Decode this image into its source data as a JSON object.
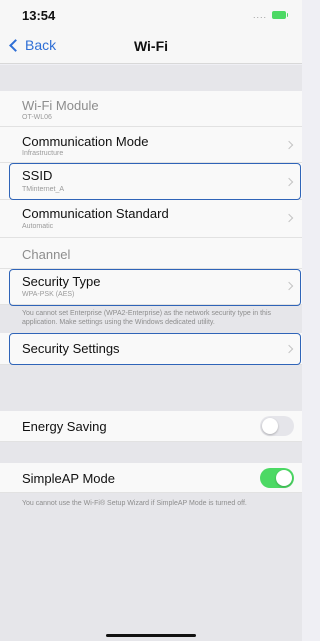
{
  "status_bar": {
    "time": "13:54",
    "signal": "....",
    "battery_color": "#4cd964"
  },
  "nav": {
    "back_label": "Back",
    "title": "Wi-Fi"
  },
  "settings": {
    "wifi_module": {
      "label": "Wi-Fi Module",
      "value": "OT-WL06"
    },
    "communication_mode": {
      "label": "Communication Mode",
      "value": "Infrastructure"
    },
    "ssid": {
      "label": "SSID",
      "value": "TMinternet_A"
    },
    "communication_standard": {
      "label": "Communication Standard",
      "value": "Automatic"
    },
    "channel": {
      "label": "Channel"
    },
    "security_type": {
      "label": "Security Type",
      "value": "WPA-PSK (AES)"
    },
    "security_note": "You cannot set Enterprise (WPA2-Enterprise) as the network security type in this application. Make settings using the Windows dedicated utility.",
    "security_settings": {
      "label": "Security Settings"
    },
    "energy_saving": {
      "label": "Energy Saving",
      "enabled": false
    },
    "simpleap_mode": {
      "label": "SimpleAP Mode",
      "enabled": true
    },
    "simpleap_note": "You cannot use the Wi-Fi® Setup Wizard if SimpleAP Mode is turned off."
  },
  "colors": {
    "accent": "#2f6fd6",
    "toggle_on": "#4cd964",
    "highlight_outline": "#2f64b8"
  }
}
